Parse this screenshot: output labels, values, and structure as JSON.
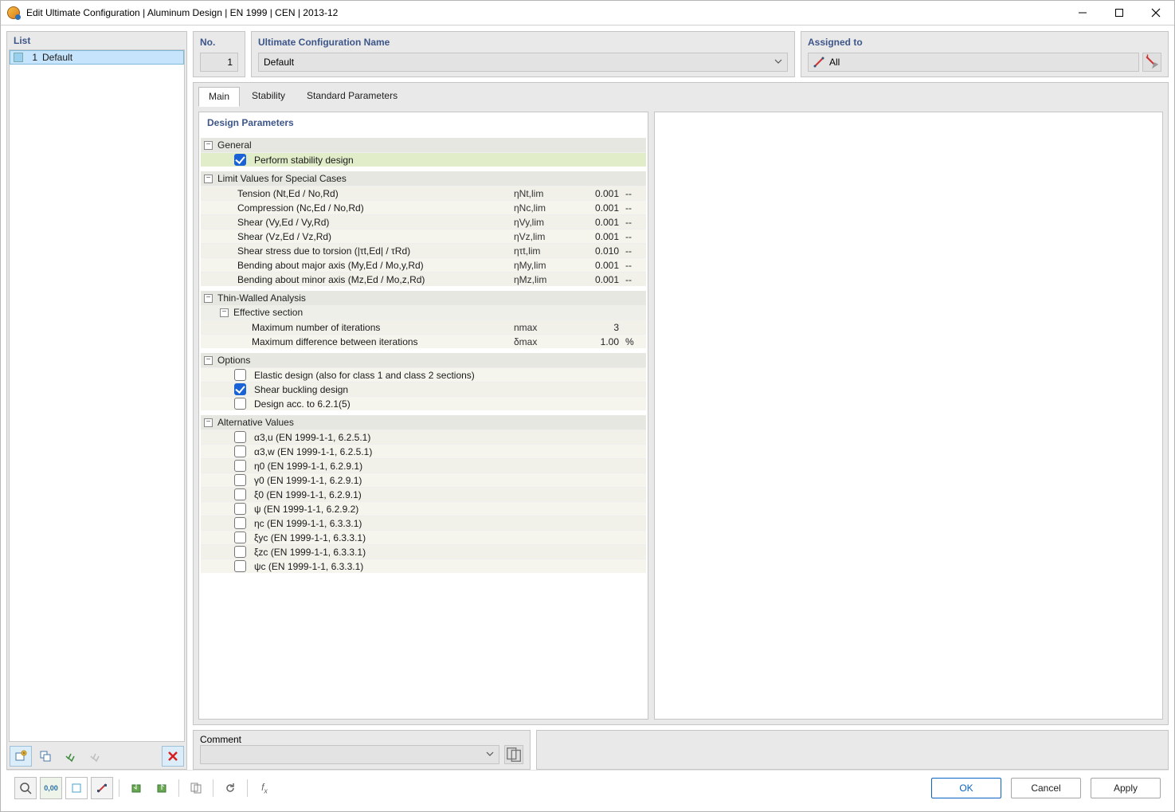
{
  "window": {
    "title": "Edit Ultimate Configuration | Aluminum Design | EN 1999 | CEN | 2013-12"
  },
  "left": {
    "header": "List",
    "items": [
      {
        "num": "1",
        "label": "Default"
      }
    ]
  },
  "header_row": {
    "no_label": "No.",
    "no_value": "1",
    "name_label": "Ultimate Configuration Name",
    "name_value": "Default",
    "assigned_label": "Assigned to",
    "assigned_value": "All"
  },
  "tabs": {
    "main": "Main",
    "stability": "Stability",
    "standard": "Standard Parameters"
  },
  "params_title": "Design Parameters",
  "groups": {
    "general": {
      "title": "General",
      "stability_design": "Perform stability design"
    },
    "limits": {
      "title": "Limit Values for Special Cases",
      "rows": [
        {
          "label": "Tension (Nt,Ed / No,Rd)",
          "sym": "ηNt,lim",
          "val": "0.001",
          "unit": "--"
        },
        {
          "label": "Compression (Nc,Ed / No,Rd)",
          "sym": "ηNc,lim",
          "val": "0.001",
          "unit": "--"
        },
        {
          "label": "Shear (Vy,Ed / Vy,Rd)",
          "sym": "ηVy,lim",
          "val": "0.001",
          "unit": "--"
        },
        {
          "label": "Shear (Vz,Ed / Vz,Rd)",
          "sym": "ηVz,lim",
          "val": "0.001",
          "unit": "--"
        },
        {
          "label": "Shear stress due to torsion (|τt,Ed| / τRd)",
          "sym": "ητt,lim",
          "val": "0.010",
          "unit": "--"
        },
        {
          "label": "Bending about major axis (My,Ed / Mo,y,Rd)",
          "sym": "ηMy,lim",
          "val": "0.001",
          "unit": "--"
        },
        {
          "label": "Bending about minor axis (Mz,Ed / Mo,z,Rd)",
          "sym": "ηMz,lim",
          "val": "0.001",
          "unit": "--"
        }
      ]
    },
    "thin": {
      "title": "Thin-Walled Analysis",
      "sub_title": "Effective section",
      "rows": [
        {
          "label": "Maximum number of iterations",
          "sym": "nmax",
          "val": "3",
          "unit": ""
        },
        {
          "label": "Maximum difference between iterations",
          "sym": "δmax",
          "val": "1.00",
          "unit": "%"
        }
      ]
    },
    "options": {
      "title": "Options",
      "elastic": "Elastic design (also for class 1 and class 2 sections)",
      "shear": "Shear buckling design",
      "d621": "Design acc. to 6.2.1(5)"
    },
    "alt": {
      "title": "Alternative Values",
      "rows": [
        "α3,u (EN 1999-1-1, 6.2.5.1)",
        "α3,w (EN 1999-1-1, 6.2.5.1)",
        "η0 (EN 1999-1-1, 6.2.9.1)",
        "γ0 (EN 1999-1-1, 6.2.9.1)",
        "ξ0 (EN 1999-1-1, 6.2.9.1)",
        "ψ (EN 1999-1-1, 6.2.9.2)",
        "ηc (EN 1999-1-1, 6.3.3.1)",
        "ξyc (EN 1999-1-1, 6.3.3.1)",
        "ξzc (EN 1999-1-1, 6.3.3.1)",
        "ψc (EN 1999-1-1, 6.3.3.1)"
      ]
    }
  },
  "comment": {
    "label": "Comment",
    "value": ""
  },
  "footer": {
    "ok": "OK",
    "cancel": "Cancel",
    "apply": "Apply"
  }
}
